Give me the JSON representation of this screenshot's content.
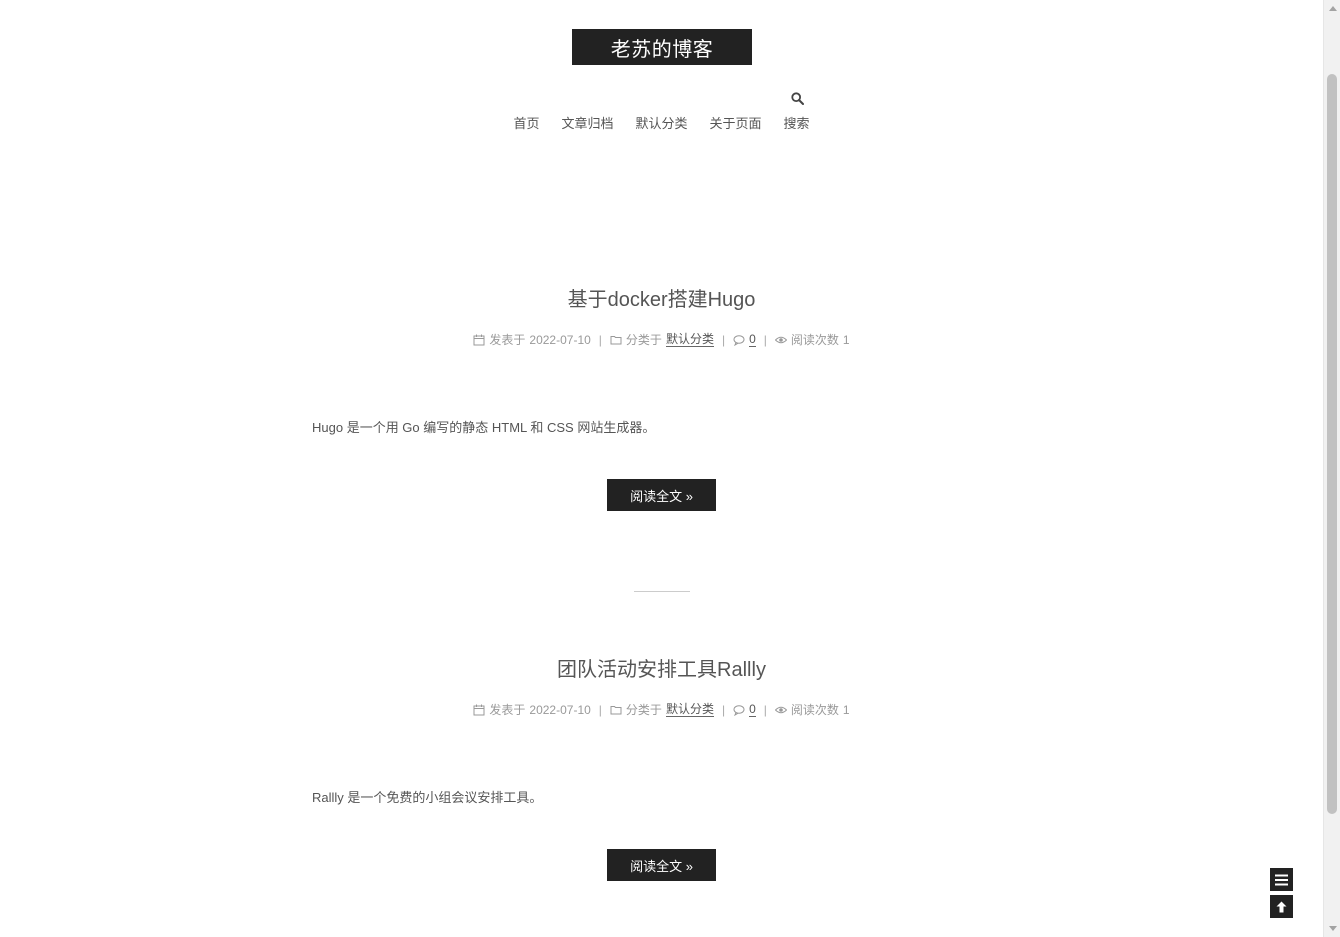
{
  "site": {
    "title": "老苏的博客"
  },
  "nav": {
    "items": [
      {
        "label": "首页"
      },
      {
        "label": "文章归档"
      },
      {
        "label": "默认分类"
      },
      {
        "label": "关于页面"
      },
      {
        "label": "搜索"
      }
    ],
    "search_icon": "search-icon"
  },
  "posts": [
    {
      "title": "基于docker搭建Hugo",
      "posted_prefix": "发表于",
      "date": "2022-07-10",
      "category_prefix": "分类于",
      "category": "默认分类",
      "comments": "0",
      "views_label": "阅读次数",
      "views": "1",
      "excerpt": "Hugo 是一个用 Go 编写的静态 HTML 和 CSS 网站生成器。",
      "read_more": "阅读全文 »"
    },
    {
      "title": "团队活动安排工具Rallly",
      "posted_prefix": "发表于",
      "date": "2022-07-10",
      "category_prefix": "分类于",
      "category": "默认分类",
      "comments": "0",
      "views_label": "阅读次数",
      "views": "1",
      "excerpt": "Rallly 是一个免费的小组会议安排工具。",
      "read_more": "阅读全文 »"
    }
  ],
  "sidebar_toggle": {
    "menu_icon": "menu-icon",
    "back_to_top_icon": "arrow-up-icon"
  },
  "colors": {
    "brand_bg": "#222222",
    "text": "#555555",
    "meta": "#999999"
  }
}
